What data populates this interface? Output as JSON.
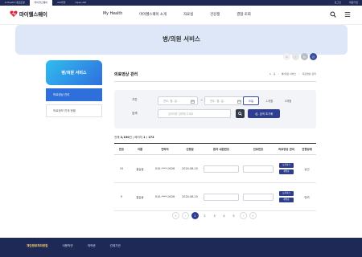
{
  "topbar": {
    "left": [
      "K-Health 대표포털",
      "마이헬스웨이",
      "API마켓",
      "Open-API"
    ],
    "right": [
      "로그인",
      "회원가입"
    ]
  },
  "header": {
    "logo_text": "마이헬스웨이",
    "nav": [
      "My Health",
      "마이헬스웨이 소개",
      "자료실",
      "건강쟁",
      "결합·조회"
    ]
  },
  "hero": {
    "title": "병/의원 서비스"
  },
  "sidebar": {
    "title": "병/의원 서비스",
    "items": [
      "의료영상 관리",
      "의료정보 연계 현황"
    ]
  },
  "content": {
    "title": "의료영상 관리",
    "breadcrumb": [
      "홈",
      "병/의원 서비스",
      "의료영상 관리"
    ]
  },
  "search": {
    "period_label": "기간",
    "date_placeholder": "연도. 월. 일.",
    "dash": "~",
    "period_buttons": [
      "오늘",
      "1개월",
      "3개월"
    ],
    "keyword_label": "검색",
    "keyword_placeholder": "검색어를 입력해 주세요",
    "reset_label": "검색 초기화"
  },
  "list": {
    "total_prefix": "전체",
    "total_count": "2,150",
    "total_suffix": "건 | 페이지",
    "page_info": "1 / 172",
    "columns": [
      "번호",
      "이름",
      "연락처",
      "신청일",
      "환자 내원번호",
      "진료번호",
      "의료영상 관리",
      "진행상태"
    ],
    "rows": [
      {
        "no": "10",
        "name": "홍길동",
        "phone": "010-****-0026",
        "date": "2024-06-20",
        "btn1": "등록하기",
        "btn2": "재발송",
        "status": "승인"
      },
      {
        "no": "9",
        "name": "홍길동",
        "phone": "010-****-0026",
        "date": "2024-06-20",
        "btn1": "등록하기",
        "btn2": "재발송",
        "status": "반려"
      }
    ]
  },
  "pagination": {
    "pages": [
      "1",
      "2",
      "3",
      "4",
      "5"
    ],
    "current": "1",
    "first": "«",
    "prev": "‹",
    "next": "›",
    "last": "»"
  },
  "footer": {
    "links": [
      "개인정보처리방침",
      "이용약관",
      "저작권",
      "관계기관"
    ]
  },
  "colors": {
    "primary": "#2e3d8f",
    "accent": "#2f6fdc",
    "header_bg": "#1e2a55",
    "hero_bg": "#dde7f8"
  }
}
